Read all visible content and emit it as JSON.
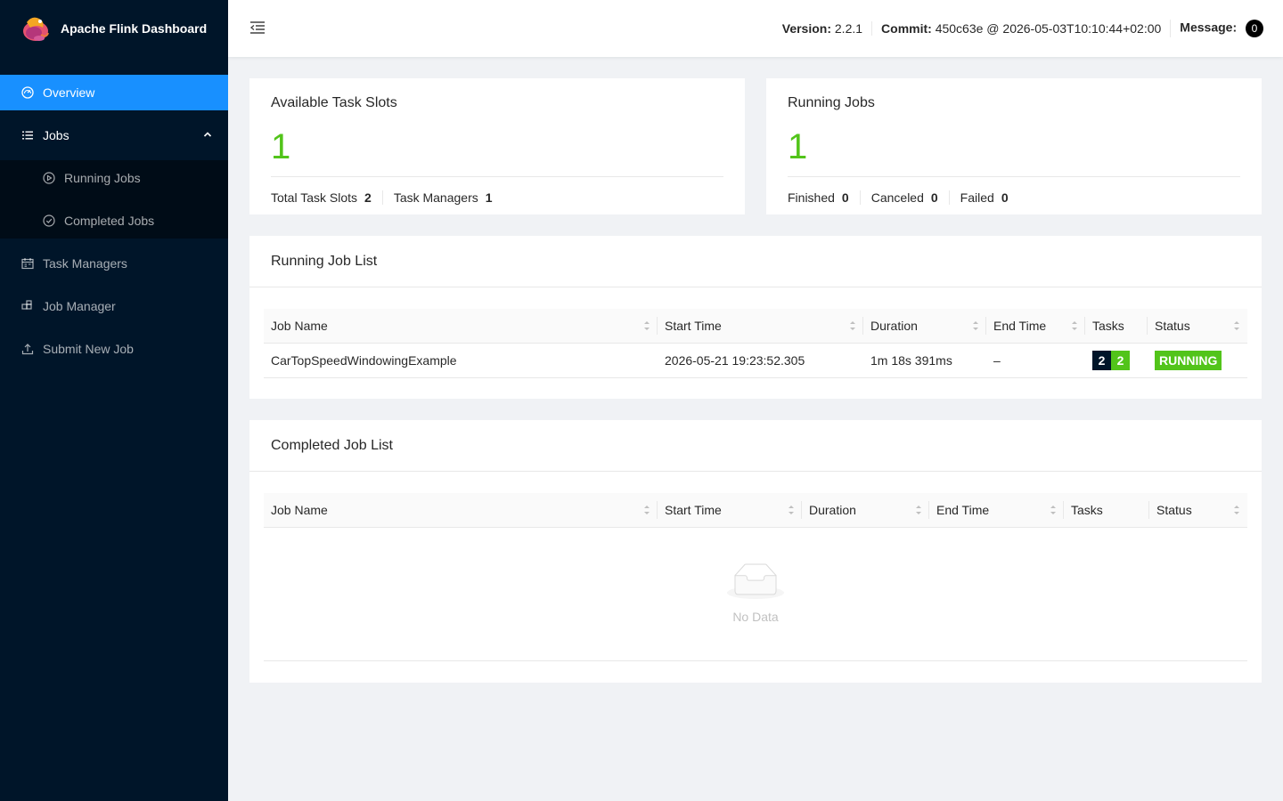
{
  "app": {
    "title": "Apache Flink Dashboard"
  },
  "sidebar": {
    "items": [
      {
        "label": "Overview",
        "icon": "dashboard-icon",
        "active": true
      },
      {
        "label": "Jobs",
        "icon": "list-icon"
      },
      {
        "label": "Running Jobs",
        "icon": "play-circle-icon"
      },
      {
        "label": "Completed Jobs",
        "icon": "check-circle-icon"
      },
      {
        "label": "Task Managers",
        "icon": "schedule-icon"
      },
      {
        "label": "Job Manager",
        "icon": "build-icon"
      },
      {
        "label": "Submit New Job",
        "icon": "upload-icon"
      }
    ]
  },
  "header": {
    "version_label": "Version:",
    "version_value": "2.2.1",
    "commit_label": "Commit:",
    "commit_value": "450c63e @ 2026-05-03T10:10:44+02:00",
    "message_label": "Message:",
    "message_count": "0"
  },
  "slots": {
    "title": "Available Task Slots",
    "value": "1",
    "total_label": "Total Task Slots",
    "total_value": "2",
    "tm_label": "Task Managers",
    "tm_value": "1"
  },
  "jobs": {
    "title": "Running Jobs",
    "value": "1",
    "finished_label": "Finished",
    "finished_value": "0",
    "canceled_label": "Canceled",
    "canceled_value": "0",
    "failed_label": "Failed",
    "failed_value": "0"
  },
  "running_list": {
    "title": "Running Job List",
    "columns": [
      "Job Name",
      "Start Time",
      "Duration",
      "End Time",
      "Tasks",
      "Status"
    ],
    "rows": [
      {
        "name": "CarTopSpeedWindowingExample",
        "start": "2026-05-21 19:23:52.305",
        "duration": "1m 18s 391ms",
        "end": "–",
        "tasks_total": "2",
        "tasks_running": "2",
        "status": "RUNNING"
      }
    ]
  },
  "completed_list": {
    "title": "Completed Job List",
    "columns": [
      "Job Name",
      "Start Time",
      "Duration",
      "End Time",
      "Tasks",
      "Status"
    ],
    "empty_text": "No Data"
  },
  "colors": {
    "sidebar": "#001529",
    "accent": "#1890ff",
    "success": "#52c41a"
  }
}
